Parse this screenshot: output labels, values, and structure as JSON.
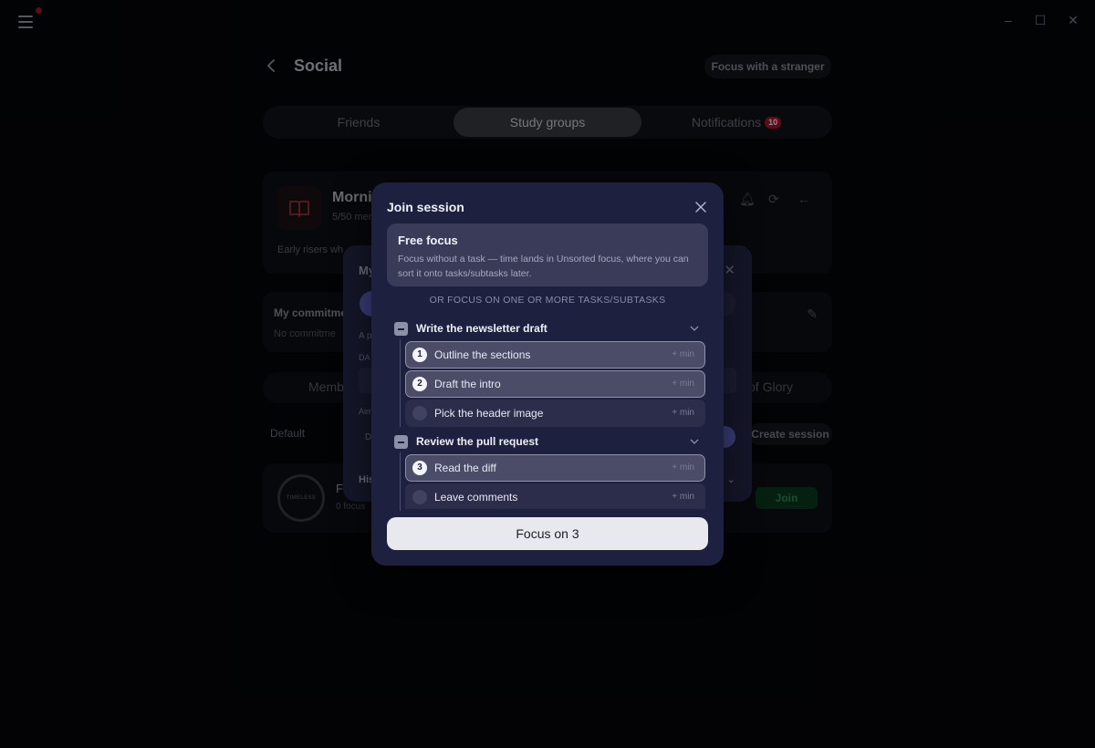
{
  "window": {
    "controls": [
      "minimize",
      "maximize",
      "close"
    ]
  },
  "header": {
    "title": "Social",
    "stranger_button": "Focus with a stranger"
  },
  "tabs": [
    {
      "label": "Friends",
      "active": false
    },
    {
      "label": "Study groups",
      "active": true
    },
    {
      "label": "Notifications",
      "active": false,
      "badge": "10"
    }
  ],
  "group": {
    "name": "Morni",
    "members": "5/50 mem",
    "description": "Early risers wh"
  },
  "commitment": {
    "title": "My commitme",
    "subtitle": "No commitme"
  },
  "subtabs": {
    "left": "Memb",
    "right": "of Glory"
  },
  "sessions": {
    "default_label": "Default",
    "create_label": "Create session"
  },
  "timeless": {
    "ring_label": "TIMELESS",
    "title": "F",
    "subtitle": "0 focus",
    "join_label": "Join"
  },
  "mid_modal": {
    "title": "My",
    "line_a": "A p",
    "line_b": "DA",
    "line_c": "Aim",
    "line_d": "D",
    "line_e": "His"
  },
  "modal": {
    "title": "Join session",
    "free_focus": {
      "title": "Free focus",
      "description": "Focus without a task — time lands in Unsorted focus, where you can sort it onto tasks/subtasks later."
    },
    "or_label": "OR FOCUS ON ONE OR MORE TASKS/SUBTASKS",
    "tasks": [
      {
        "title": "Write the newsletter draft",
        "subtasks": [
          {
            "label": "Outline the sections",
            "order": "1",
            "min": "+ min"
          },
          {
            "label": "Draft the intro",
            "order": "2",
            "min": "+ min"
          },
          {
            "label": "Pick the header image",
            "order": "",
            "min": "+ min"
          }
        ]
      },
      {
        "title": "Review the pull request",
        "subtasks": [
          {
            "label": "Read the diff",
            "order": "3",
            "min": "+ min"
          },
          {
            "label": "Leave comments",
            "order": "",
            "min": "+ min"
          }
        ]
      }
    ],
    "focus_button": "Focus on 3"
  }
}
